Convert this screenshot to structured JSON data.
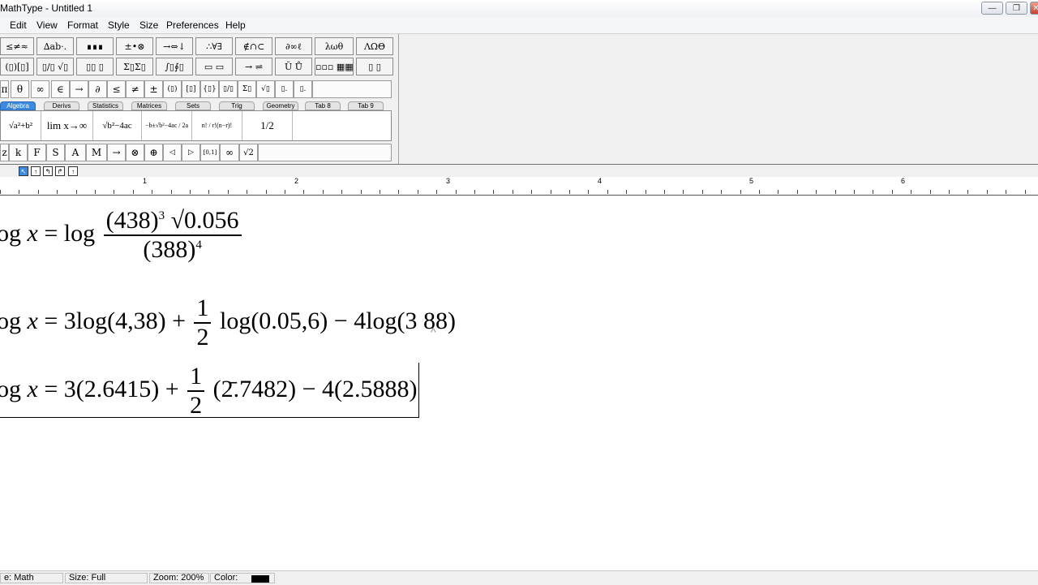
{
  "window": {
    "title": "MathType - Untitled 1",
    "controls": {
      "minimize": "—",
      "restore": "❐",
      "close": "✕"
    }
  },
  "menu": [
    "Edit",
    "View",
    "Format",
    "Style",
    "Size",
    "Preferences",
    "Help"
  ],
  "symbol_palettes": {
    "row1": [
      "≤≠≈",
      "∆ab·.",
      "∎∎∎",
      "±•⊗",
      "→⇔↓",
      "∴∀∃",
      "∉∩⊂",
      "∂∞ℓ",
      "λωθ",
      "ΛΩΘ"
    ],
    "row2": [
      "(▯)[▯]",
      "▯/▯ √▯",
      "▯▯ ▯",
      "Σ▯Σ▯",
      "∫▯∮▯",
      "▭ ▭",
      "→ ⇌",
      "Ū Ů",
      "▫▫▫ ▦▦",
      "▯ ▯"
    ]
  },
  "small_tools": [
    "π",
    "θ",
    "∞",
    "∈",
    "→",
    "∂",
    "≤",
    "≠",
    "±",
    "(▯)",
    "[▯]",
    "{▯}",
    "▯/▯",
    "Σ▯",
    "√▯",
    "▯.",
    "▯."
  ],
  "tabs": [
    "Algebra",
    "Derivs",
    "Statistics",
    "Matrices",
    "Sets",
    "Trig",
    "Geometry",
    "Tab 8",
    "Tab 9"
  ],
  "active_tab": "Algebra",
  "templates": [
    "√a²+b²",
    "lim x→∞",
    "√b²−4ac",
    "−b±√b²−4ac / 2a",
    "n! / r!(n−r)!",
    "1/2"
  ],
  "bottom_tools": [
    "z",
    "k",
    "F",
    "S",
    "A",
    "M",
    "→",
    "⊗",
    "⊕",
    "◁",
    "▷",
    "[0,1]",
    "∞",
    "√2"
  ],
  "nudge_buttons": [
    "↖",
    "↑",
    "↰",
    "↱",
    "↑"
  ],
  "ruler": {
    "labels": [
      "1",
      "2",
      "3",
      "4",
      "5",
      "6"
    ]
  },
  "equations": {
    "line1": {
      "lhs": "og",
      "var": "x",
      "eq": "= log",
      "num_base": "(438)",
      "num_exp": "3",
      "num_root": "√0.056",
      "den_base": "(388)",
      "den_exp": "4"
    },
    "line2": {
      "lhs": "og",
      "var": "x",
      "eq": "= 3log(4,38) +",
      "frac_num": "1",
      "frac_den": "2",
      "rest": "log(0.05,6) − 4log(3 88)"
    },
    "line3": {
      "lhs": "og",
      "var": "x",
      "eq": "= 3(2.6415) +",
      "frac_num": "1",
      "frac_den": "2",
      "rest": "(2̄.7482) − 4(2.5888)"
    },
    "caret": "^"
  },
  "status": {
    "style": "e: Math",
    "size": "Size: Full",
    "zoom": "Zoom: 200%",
    "color_label": "Color:",
    "color_value": "#000000"
  }
}
